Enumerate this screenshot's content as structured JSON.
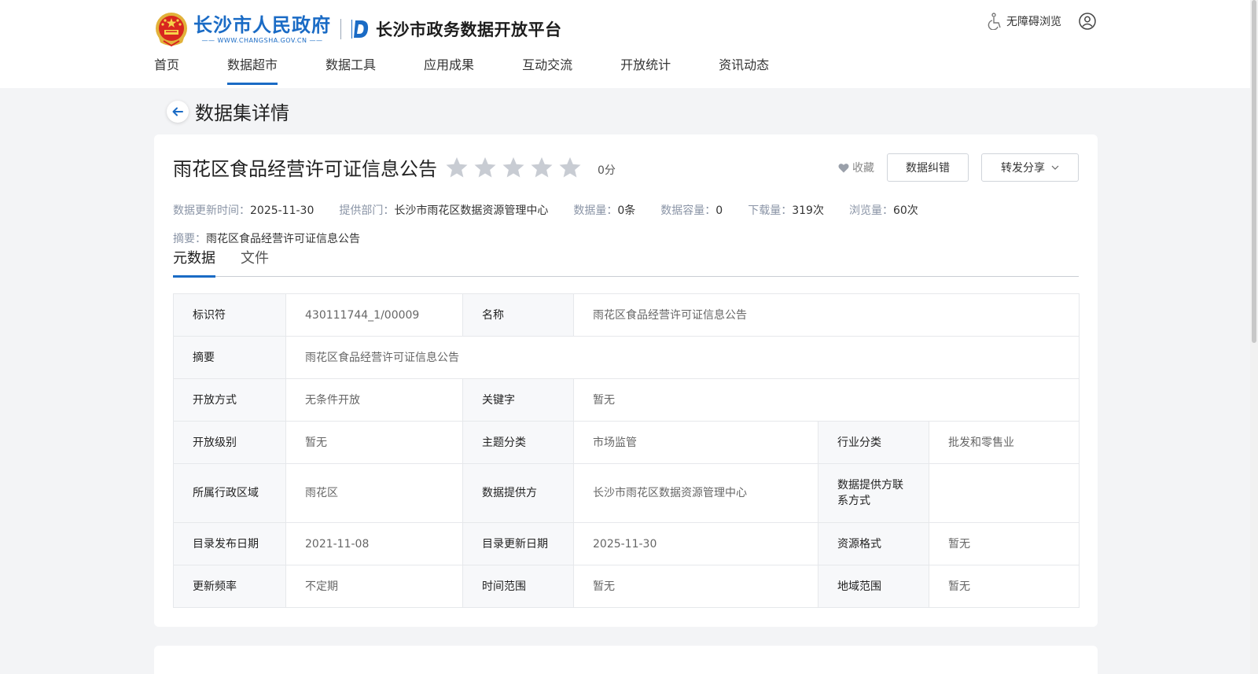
{
  "header": {
    "gov_name": "长沙市人民政府",
    "gov_url": "—— WWW.CHANGSHA.GOV.CN ——",
    "platform_name": "长沙市政务数据开放平台",
    "accessibility_label": "无障碍浏览",
    "nav": [
      {
        "label": "首页",
        "active": false
      },
      {
        "label": "数据超市",
        "active": true
      },
      {
        "label": "数据工具",
        "active": false
      },
      {
        "label": "应用成果",
        "active": false
      },
      {
        "label": "互动交流",
        "active": false
      },
      {
        "label": "开放统计",
        "active": false
      },
      {
        "label": "资讯动态",
        "active": false
      }
    ]
  },
  "page": {
    "title": "数据集详情"
  },
  "dataset": {
    "title": "雨花区食品经营许可证信息公告",
    "rating": 0,
    "rating_max": 5,
    "score_label": "0分",
    "favorite_label": "收藏",
    "report_label": "数据纠错",
    "share_label": "转发分享",
    "meta": [
      {
        "key": "数据更新时间：",
        "value": "2025-11-30"
      },
      {
        "key": "提供部门：",
        "value": "长沙市雨花区数据资源管理中心"
      },
      {
        "key": "数据量：",
        "value": "0条"
      },
      {
        "key": "数据容量：",
        "value": "0"
      },
      {
        "key": "下载量：",
        "value": "319次"
      },
      {
        "key": "浏览量：",
        "value": "60次"
      }
    ],
    "summary_key": "摘要：",
    "summary_value": "雨花区食品经营许可证信息公告"
  },
  "tabs": [
    {
      "label": "元数据",
      "active": true
    },
    {
      "label": "文件",
      "active": false
    }
  ],
  "metadata_table": {
    "identifier_label": "标识符",
    "identifier": "430111744_1/00009",
    "name_label": "名称",
    "name": "雨花区食品经营许可证信息公告",
    "abstract_label": "摘要",
    "abstract": "雨花区食品经营许可证信息公告",
    "open_mode_label": "开放方式",
    "open_mode": "无条件开放",
    "keywords_label": "关键字",
    "keywords": "暂无",
    "open_level_label": "开放级别",
    "open_level": "暂无",
    "topic_label": "主题分类",
    "topic": "市场监管",
    "industry_label": "行业分类",
    "industry": "批发和零售业",
    "region_label": "所属行政区域",
    "region": "雨花区",
    "provider_label": "数据提供方",
    "provider": "长沙市雨花区数据资源管理中心",
    "contact_label": "数据提供方联系方式",
    "contact": "",
    "publish_date_label": "目录发布日期",
    "publish_date": "2021-11-08",
    "update_date_label": "目录更新日期",
    "update_date": "2025-11-30",
    "format_label": "资源格式",
    "format": "暂无",
    "frequency_label": "更新频率",
    "frequency": "不定期",
    "time_range_label": "时间范围",
    "time_range": "暂无",
    "geo_range_label": "地域范围",
    "geo_range": "暂无"
  },
  "colors": {
    "brand_blue": "#1a6bc5",
    "star_empty": "#c8ccd3",
    "page_bg": "#f3f4f6"
  },
  "icons": {
    "emblem": "national-emblem-icon",
    "platform": "d-logo-icon",
    "accessibility": "wheelchair-icon",
    "user": "user-circle-icon",
    "back": "arrow-left-icon",
    "star": "star-icon",
    "favorite": "heart-icon",
    "share_dropdown": "chevron-down-icon"
  }
}
